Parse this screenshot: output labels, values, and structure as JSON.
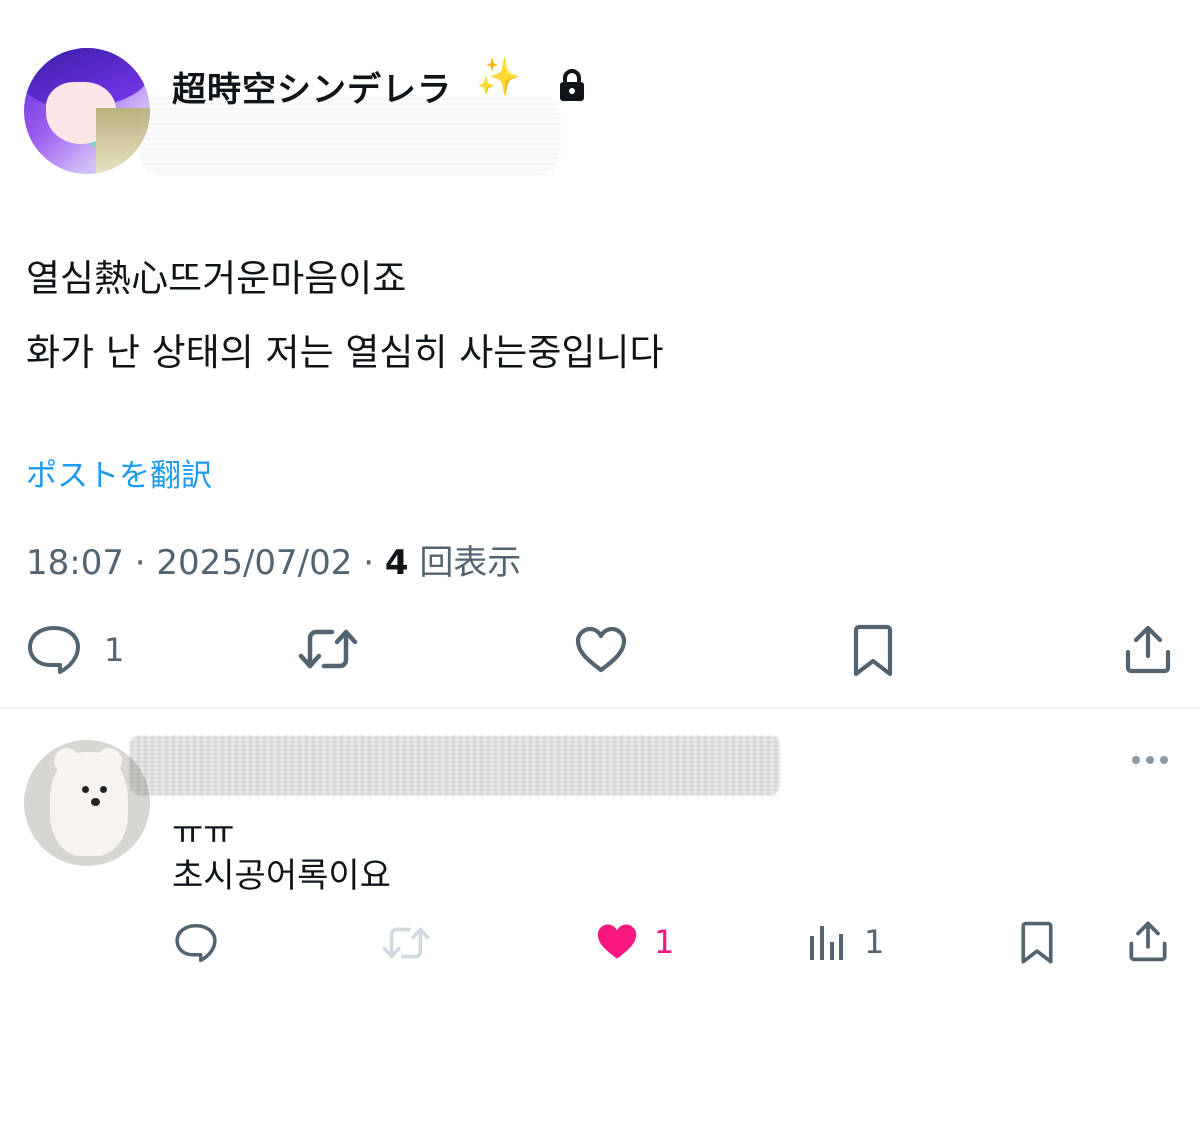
{
  "post": {
    "author": {
      "display_name": "超時空シンデレラ",
      "name_emoji": "✨",
      "protected_icon": "lock-icon"
    },
    "text_lines": [
      "열심熱心뜨거운마음이죠",
      "화가 난 상태의 저는 열심히 사는중입니다"
    ],
    "translate_label": "ポストを翻訳",
    "time": "18:07",
    "date": "2025/07/02",
    "separator": "·",
    "views_count": "4",
    "views_label": "回表示",
    "actions": {
      "reply_icon": "comment-icon",
      "reply_count": "1",
      "repost_icon": "repost-icon",
      "like_icon": "heart-outline-icon",
      "bookmark_icon": "bookmark-icon",
      "share_icon": "share-icon"
    }
  },
  "reply": {
    "text_lines": [
      "ㅠㅠ",
      "초시공어록이요"
    ],
    "more_icon": "more-dots-icon",
    "actions": {
      "reply_icon": "comment-icon",
      "repost_icon": "repost-icon-disabled",
      "like_icon": "heart-filled-icon",
      "like_count": "1",
      "views_icon": "analytics-icon",
      "views_count": "1",
      "bookmark_icon": "bookmark-icon",
      "share_icon": "share-icon"
    }
  },
  "colors": {
    "text": "#0f1419",
    "secondary": "#536471",
    "link": "#1d9bf0",
    "like": "#f91880",
    "divider": "#eff3f4",
    "disabled": "#cfd9de"
  }
}
